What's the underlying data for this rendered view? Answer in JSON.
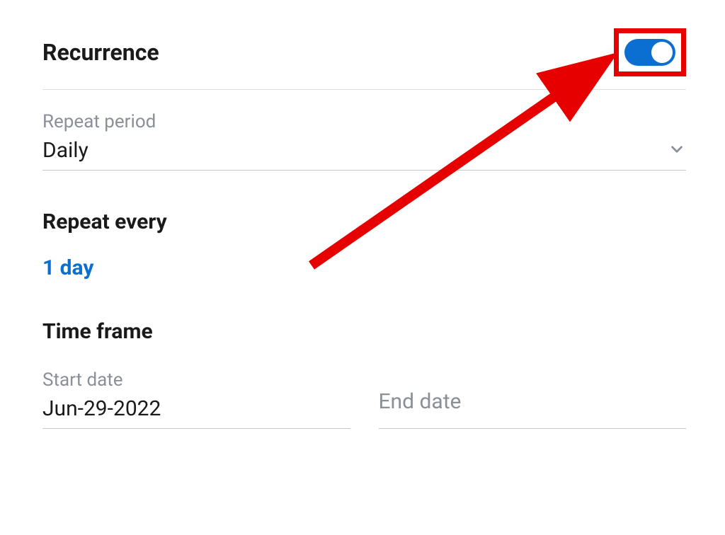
{
  "recurrence": {
    "title": "Recurrence",
    "toggle_on": true
  },
  "repeat_period": {
    "label": "Repeat period",
    "value": "Daily"
  },
  "repeat_every": {
    "title": "Repeat every",
    "value": "1 day"
  },
  "time_frame": {
    "title": "Time frame",
    "start_date_label": "Start date",
    "start_date_value": "Jun-29-2022",
    "end_date_label": "End date",
    "end_date_value": ""
  },
  "colors": {
    "accent": "#0a6fd1",
    "annotation": "#e60000"
  }
}
